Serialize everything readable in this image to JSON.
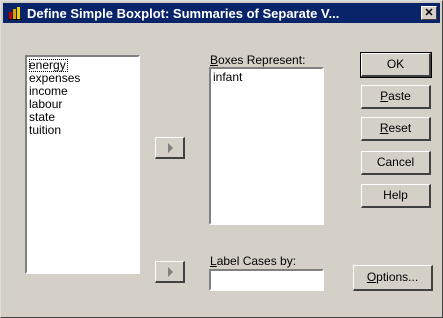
{
  "window": {
    "title": "Define Simple Boxplot: Summaries of Separate V...",
    "close_glyph": "✕"
  },
  "variables": [
    "energy",
    "expenses",
    "income",
    "labour",
    "state",
    "tuition"
  ],
  "boxes": {
    "label_prefix": "",
    "label_key": "B",
    "label_rest": "oxes Represent:",
    "items": [
      "infant"
    ]
  },
  "label_cases": {
    "label_key": "L",
    "label_rest": "abel Cases by:",
    "value": ""
  },
  "buttons": {
    "ok": "OK",
    "paste_key": "P",
    "paste_rest": "aste",
    "reset_key": "R",
    "reset_rest": "eset",
    "cancel": "Cancel",
    "help": "Help",
    "options_key": "O",
    "options_rest": "ptions..."
  }
}
